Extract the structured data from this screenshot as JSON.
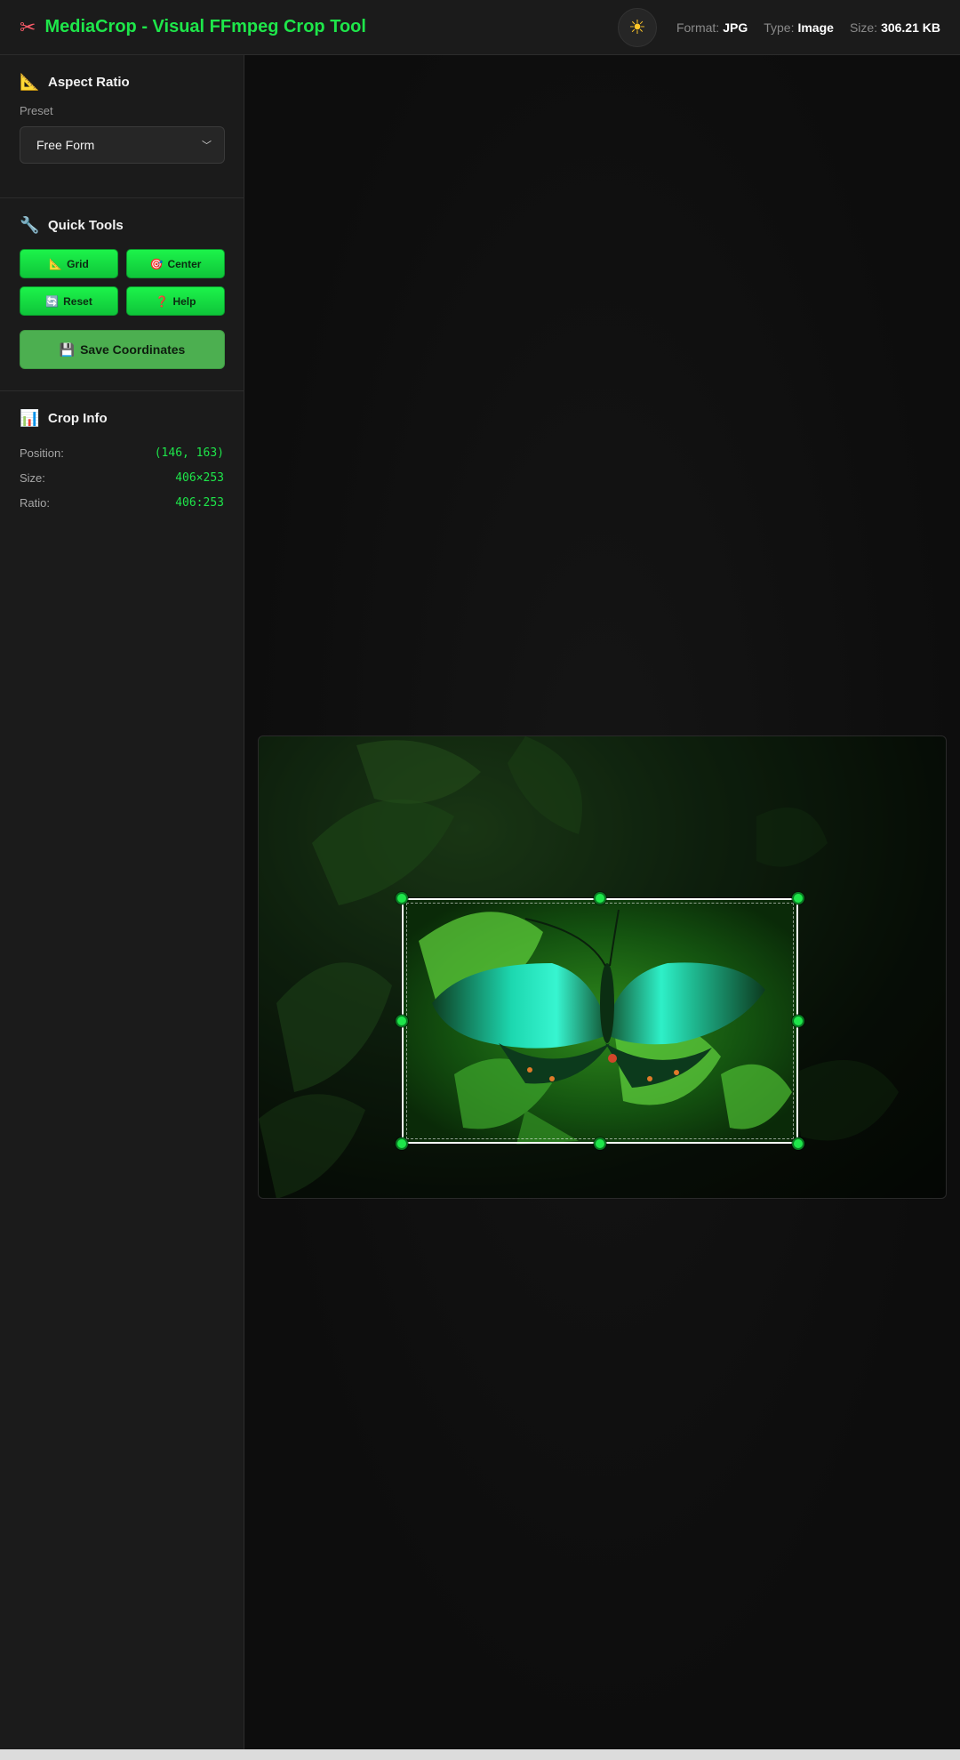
{
  "app": {
    "title": "MediaCrop - Visual FFmpeg Crop Tool",
    "icon": "scissors-icon"
  },
  "header": {
    "theme_icon": "sun-icon",
    "format_label": "Format:",
    "format_value": "JPG",
    "type_label": "Type:",
    "type_value": "Image",
    "size_label": "Size:",
    "size_value": "306.21 KB"
  },
  "aspect": {
    "title": "Aspect Ratio",
    "icon": "ruler-icon",
    "preset_label": "Preset",
    "preset_value": "Free Form"
  },
  "tools": {
    "title": "Quick Tools",
    "icon": "wrench-icon",
    "grid_label": "Grid",
    "center_label": "Center",
    "reset_label": "Reset",
    "help_label": "Help",
    "save_label": "Save Coordinates"
  },
  "crop_info": {
    "title": "Crop Info",
    "icon": "chart-icon",
    "position_label": "Position:",
    "position_value": "(146, 163)",
    "size_label": "Size:",
    "size_value": "406×253",
    "ratio_label": "Ratio:",
    "ratio_value": "406:253"
  },
  "colors": {
    "accent": "#1ee64a",
    "save": "#4caf50",
    "background": "#0e0e0e",
    "panel": "#1b1b1b"
  }
}
